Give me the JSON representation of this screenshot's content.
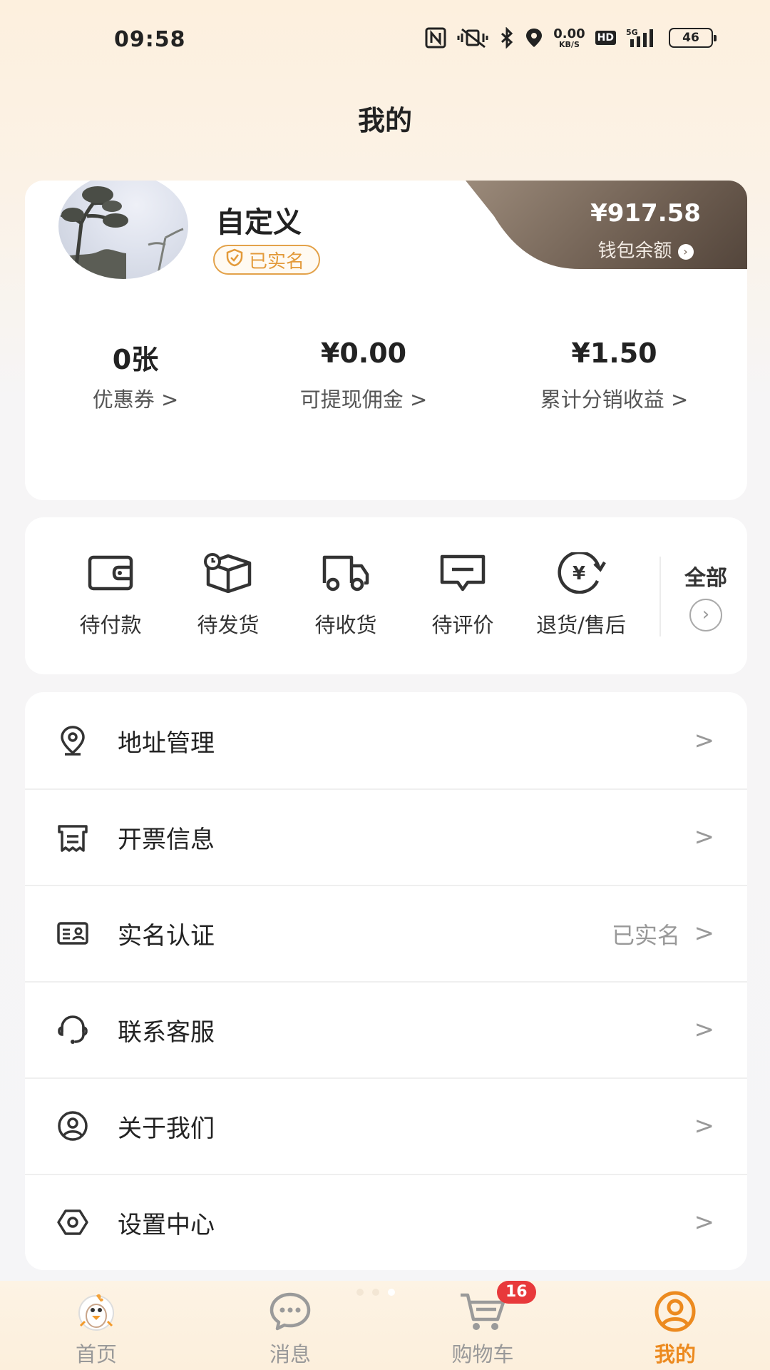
{
  "status_bar": {
    "time": "09:58",
    "net_speed_value": "0.00",
    "net_speed_unit": "KB/S",
    "hd": "HD",
    "signal": "5G",
    "battery": "46"
  },
  "header": {
    "title": "我的"
  },
  "profile": {
    "name": "自定义",
    "verified_label": "已实名",
    "wallet": {
      "amount": "¥917.58",
      "label": "钱包余额"
    },
    "stats": [
      {
        "value": "0张",
        "label": "优惠券 >"
      },
      {
        "value": "¥0.00",
        "label": "可提现佣金 >"
      },
      {
        "value": "¥1.50",
        "label": "累计分销收益 >"
      }
    ]
  },
  "orders": {
    "items": [
      {
        "label": "待付款",
        "icon": "wallet-icon"
      },
      {
        "label": "待发货",
        "icon": "package-icon"
      },
      {
        "label": "待收货",
        "icon": "truck-icon"
      },
      {
        "label": "待评价",
        "icon": "comment-icon"
      },
      {
        "label": "退货/售后",
        "icon": "refund-icon"
      }
    ],
    "all_label": "全部"
  },
  "menu": [
    {
      "label": "地址管理",
      "value": "",
      "icon": "location-icon"
    },
    {
      "label": "开票信息",
      "value": "",
      "icon": "invoice-icon"
    },
    {
      "label": "实名认证",
      "value": "已实名",
      "icon": "id-card-icon"
    },
    {
      "label": "联系客服",
      "value": "",
      "icon": "headset-icon"
    },
    {
      "label": "关于我们",
      "value": "",
      "icon": "user-circle-icon"
    },
    {
      "label": "设置中心",
      "value": "",
      "icon": "settings-icon"
    }
  ],
  "bottom_nav": {
    "items": [
      {
        "label": "首页",
        "icon": "home-mascot-icon"
      },
      {
        "label": "消息",
        "icon": "message-icon"
      },
      {
        "label": "购物车",
        "icon": "cart-icon",
        "badge": "16"
      },
      {
        "label": "我的",
        "icon": "profile-icon",
        "active": true
      }
    ]
  },
  "colors": {
    "accent": "#ec8a1f",
    "badge_red": "#e8393b",
    "wallet_bg": "#6f5f52",
    "verified_border": "#e3a24a"
  }
}
